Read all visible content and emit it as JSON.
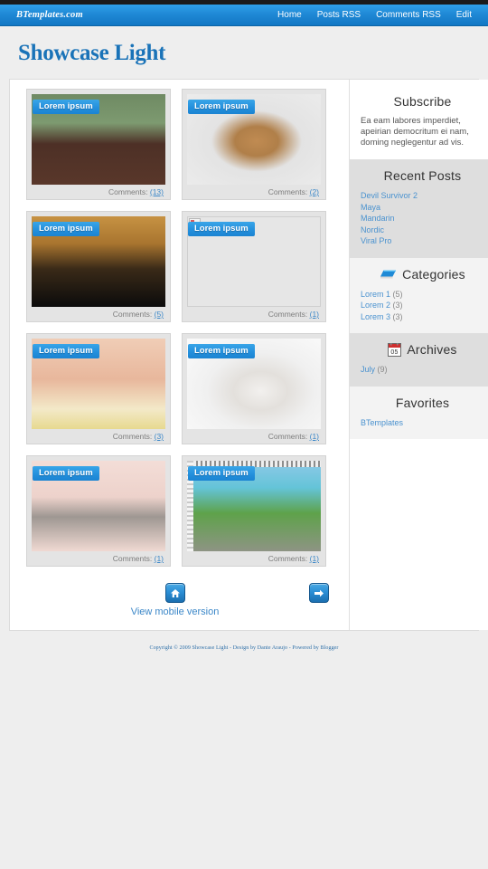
{
  "topbar": {
    "brand": "BTemplates.com",
    "nav": [
      {
        "label": "Home"
      },
      {
        "label": "Posts RSS"
      },
      {
        "label": "Comments RSS"
      },
      {
        "label": "Edit"
      }
    ]
  },
  "header": {
    "blog_title": "Showcase Light"
  },
  "posts": [
    {
      "title": "Lorem ipsum",
      "comments_label": "Comments:",
      "comments_count": "(13)",
      "image": "friends-sunglasses-dock",
      "broken": false,
      "filmstrip": false
    },
    {
      "title": "Lorem ipsum",
      "comments_label": "Comments:",
      "comments_count": "(2)",
      "image": "brown-bunny-rabbit",
      "broken": false,
      "filmstrip": false
    },
    {
      "title": "Lorem ipsum",
      "comments_label": "Comments:",
      "comments_count": "(5)",
      "image": "woman-veil-portrait",
      "broken": false,
      "filmstrip": false
    },
    {
      "title": "Lorem ipsum",
      "comments_label": "Comments:",
      "comments_count": "(1)",
      "image": "broken-image",
      "broken": true,
      "filmstrip": false
    },
    {
      "title": "Lorem ipsum",
      "comments_label": "Comments:",
      "comments_count": "(3)",
      "image": "woman-daisies-face",
      "broken": false,
      "filmstrip": false
    },
    {
      "title": "Lorem ipsum",
      "comments_label": "Comments:",
      "comments_count": "(1)",
      "image": "white-puppy-dog",
      "broken": false,
      "filmstrip": false
    },
    {
      "title": "Lorem ipsum",
      "comments_label": "Comments:",
      "comments_count": "(1)",
      "image": "kitten-pink-blanket",
      "broken": false,
      "filmstrip": false
    },
    {
      "title": "Lorem ipsum",
      "comments_label": "Comments:",
      "comments_count": "(1)",
      "image": "mayan-ruins-coast",
      "broken": false,
      "filmstrip": true
    }
  ],
  "pager": {
    "home_icon": "home-icon",
    "next_icon": "arrow-right-icon",
    "mobile_link": "View mobile version"
  },
  "sidebar": {
    "subscribe": {
      "title": "Subscribe",
      "text": "Ea eam labores imperdiet, apeirian democritum ei nam, doming neglegentur ad vis."
    },
    "recent_posts": {
      "title": "Recent Posts",
      "items": [
        {
          "label": "Devil Survivor 2"
        },
        {
          "label": "Maya"
        },
        {
          "label": "Mandarin"
        },
        {
          "label": "Nordic"
        },
        {
          "label": "Viral Pro"
        }
      ]
    },
    "categories": {
      "title": "Categories",
      "icon": "folder-icon",
      "items": [
        {
          "label": "Lorem 1",
          "count": "(5)"
        },
        {
          "label": "Lorem 2",
          "count": "(3)"
        },
        {
          "label": "Lorem 3",
          "count": "(3)"
        }
      ]
    },
    "archives": {
      "title": "Archives",
      "icon": "calendar-icon",
      "icon_day": "05",
      "items": [
        {
          "label": "July",
          "count": "(9)"
        }
      ]
    },
    "favorites": {
      "title": "Favorites",
      "items": [
        {
          "label": "BTemplates"
        }
      ]
    }
  },
  "footer": {
    "text": "Copyright © 2009 Showcase Light - Design by Dante Araujo - Powered by Blogger"
  },
  "colors": {
    "accent_blue": "#1e87d4",
    "link_blue": "#4a92cf",
    "title_blue": "#1a73b8",
    "page_bg": "#eeeeee"
  }
}
